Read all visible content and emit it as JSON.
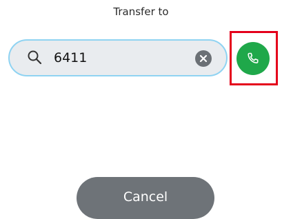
{
  "dialog": {
    "title": "Transfer to"
  },
  "search": {
    "value": "6411",
    "icon": "search-icon",
    "clear_icon": "clear-icon"
  },
  "call": {
    "icon": "phone-icon",
    "color": "#1fa84a",
    "highlight_color": "#e4001b"
  },
  "cancel": {
    "label": "Cancel"
  }
}
